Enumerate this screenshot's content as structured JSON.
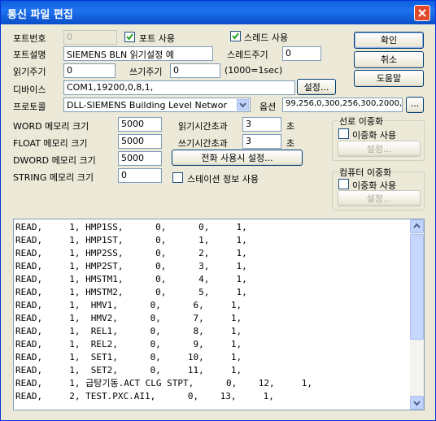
{
  "window": {
    "title": "통신 파일 편집"
  },
  "port": {
    "port_number_label": "포트번호",
    "port_number_value": "0",
    "use_port_label": "포트 사용",
    "use_port_checked": true,
    "thread_use_label": "스레드 사용",
    "thread_use_checked": true,
    "description_label": "포트설명",
    "description_value": "SIEMENS BLN 읽기설정 예",
    "thread_cycle_label": "스레드주기",
    "thread_cycle_value": "0",
    "read_cycle_label": "읽기주기",
    "read_cycle_value": "0",
    "write_cycle_label": "쓰기주기",
    "write_cycle_value": "0",
    "cycle_unit_note": "(1000=1sec)",
    "device_label": "디바이스",
    "device_value": "COM1,19200,0,8,1,",
    "device_settings_button": "설정...",
    "protocol_label": "프로토콜",
    "protocol_value": "DLL-SIEMENS Building Level Networ",
    "options_label": "옵션",
    "options_value": "99,256,0,300,256,300,2000,",
    "options_button": "..."
  },
  "memory": {
    "word_label": "WORD 메모리 크기",
    "word_value": "5000",
    "float_label": "FLOAT 메모리 크기",
    "float_value": "5000",
    "dword_label": "DWORD 메모리 크기",
    "dword_value": "5000",
    "string_label": "STRING 메모리 크기",
    "string_value": "0"
  },
  "timeouts": {
    "read_timeout_label": "읽기시간초과",
    "read_timeout_value": "3",
    "write_timeout_label": "쓰기시간초과",
    "write_timeout_value": "3",
    "unit": "초",
    "phone_settings_button": "전화 사용시 설정...",
    "station_info_label": "스테이션 정보 사용",
    "station_info_checked": false
  },
  "buttons": {
    "ok": "확인",
    "cancel": "취소",
    "help": "도움말"
  },
  "line_redundancy": {
    "title": "선로 이중화",
    "use_label": "이중화 사용",
    "checked": false,
    "settings_button": "설정..."
  },
  "computer_redundancy": {
    "title": "컴퓨터 이중화",
    "use_label": "이중화 사용",
    "checked": false,
    "settings_button": "설정..."
  },
  "log": {
    "text": "READ,     1, HMP1SS,      0,      0,     1,\nREAD,     1, HMP1ST,      0,      1,     1,\nREAD,     1, HMP2SS,      0,      2,     1,\nREAD,     1, HMP2ST,      0,      3,     1,\nREAD,     1, HMSTM1,      0,      4,     1,\nREAD,     1, HMSTM2,      0,      5,     1,\nREAD,     1,  HMV1,      0,      6,     1,\nREAD,     1,  HMV2,      0,      7,     1,\nREAD,     1,  REL1,      0,      8,     1,\nREAD,     1,  REL2,      0,      9,     1,\nREAD,     1,  SET1,      0,     10,     1,\nREAD,     1,  SET2,      0,     11,     1,\nREAD,     1, 급탕기동.ACT CLG STPT,      0,    12,     1,\nREAD,     2, TEST.PXC.AI1,      0,    13,     1,"
  }
}
